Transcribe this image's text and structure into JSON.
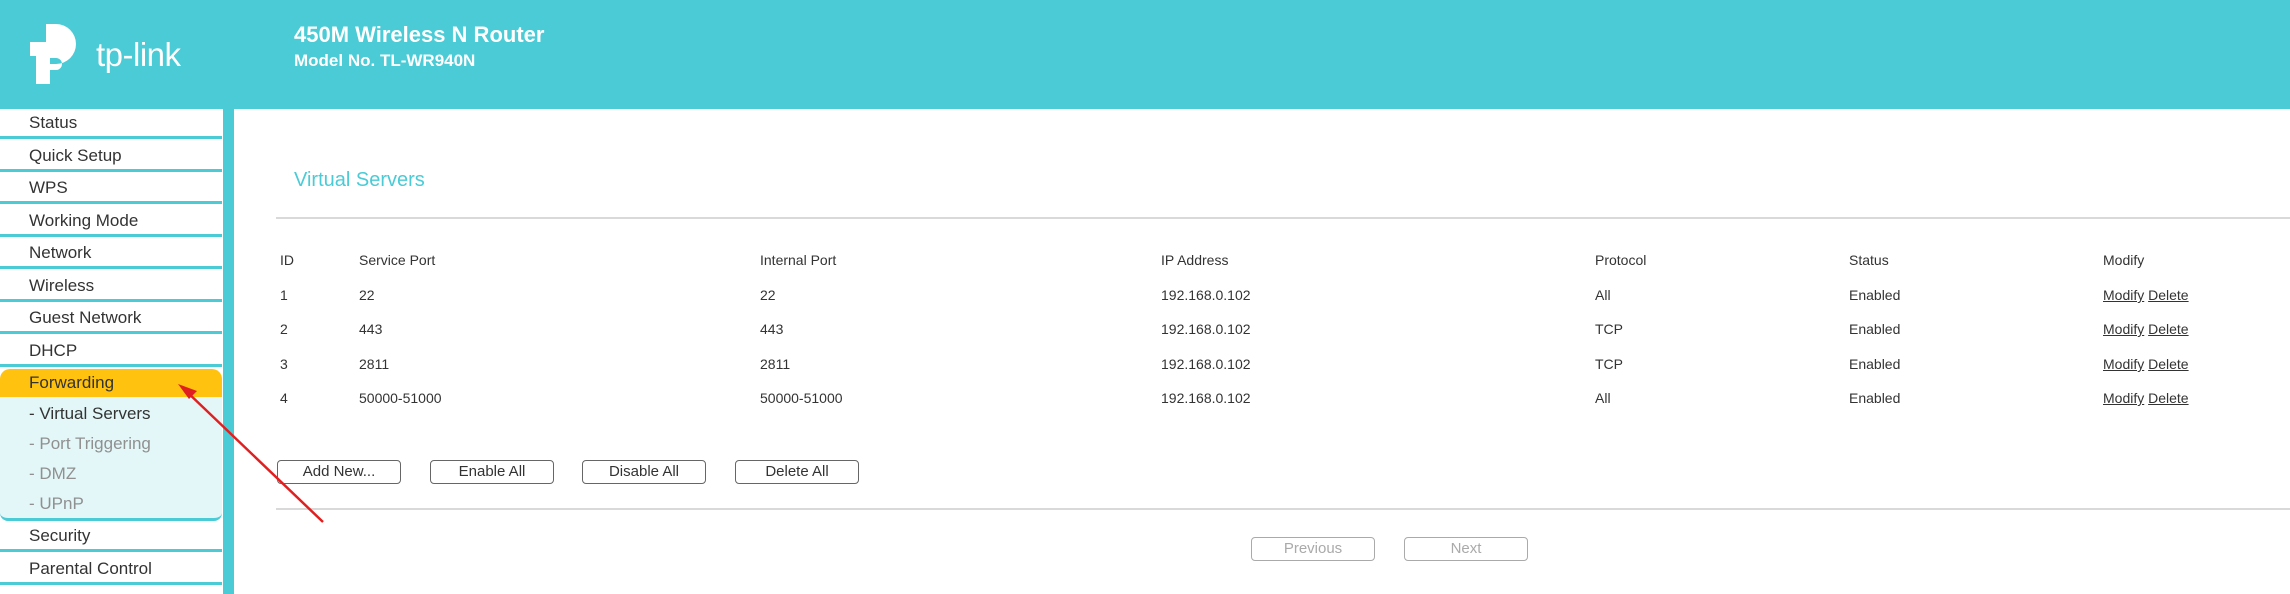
{
  "header": {
    "brand": "tp-link",
    "product": "450M Wireless N Router",
    "model": "Model No. TL-WR940N",
    "background_color": "#4acbd6"
  },
  "sidebar": {
    "items": [
      {
        "label": "Status"
      },
      {
        "label": "Quick Setup"
      },
      {
        "label": "WPS"
      },
      {
        "label": "Working Mode"
      },
      {
        "label": "Network"
      },
      {
        "label": "Wireless"
      },
      {
        "label": "Guest Network"
      },
      {
        "label": "DHCP"
      },
      {
        "label": "Forwarding",
        "active": true
      },
      {
        "label": "Security"
      },
      {
        "label": "Parental Control"
      }
    ],
    "sub_items": [
      {
        "label": "- Virtual Servers",
        "current": true
      },
      {
        "label": "- Port Triggering"
      },
      {
        "label": "- DMZ"
      },
      {
        "label": "- UPnP"
      }
    ],
    "active_color": "#ffc20e"
  },
  "main": {
    "title": "Virtual Servers",
    "columns": [
      "ID",
      "Service Port",
      "Internal Port",
      "IP Address",
      "Protocol",
      "Status",
      "Modify"
    ],
    "rows": [
      {
        "id": "1",
        "service_port": "22",
        "internal_port": "22",
        "ip": "192.168.0.102",
        "protocol": "All",
        "status": "Enabled",
        "modify": "Modify",
        "delete": "Delete"
      },
      {
        "id": "2",
        "service_port": "443",
        "internal_port": "443",
        "ip": "192.168.0.102",
        "protocol": "TCP",
        "status": "Enabled",
        "modify": "Modify",
        "delete": "Delete"
      },
      {
        "id": "3",
        "service_port": "2811",
        "internal_port": "2811",
        "ip": "192.168.0.102",
        "protocol": "TCP",
        "status": "Enabled",
        "modify": "Modify",
        "delete": "Delete"
      },
      {
        "id": "4",
        "service_port": "50000-51000",
        "internal_port": "50000-51000",
        "ip": "192.168.0.102",
        "protocol": "All",
        "status": "Enabled",
        "modify": "Modify",
        "delete": "Delete"
      }
    ],
    "buttons": {
      "add_new": "Add New...",
      "enable_all": "Enable All",
      "disable_all": "Disable All",
      "delete_all": "Delete All",
      "previous": "Previous",
      "next": "Next"
    }
  },
  "annotation": {
    "arrow_color": "#e02020"
  }
}
